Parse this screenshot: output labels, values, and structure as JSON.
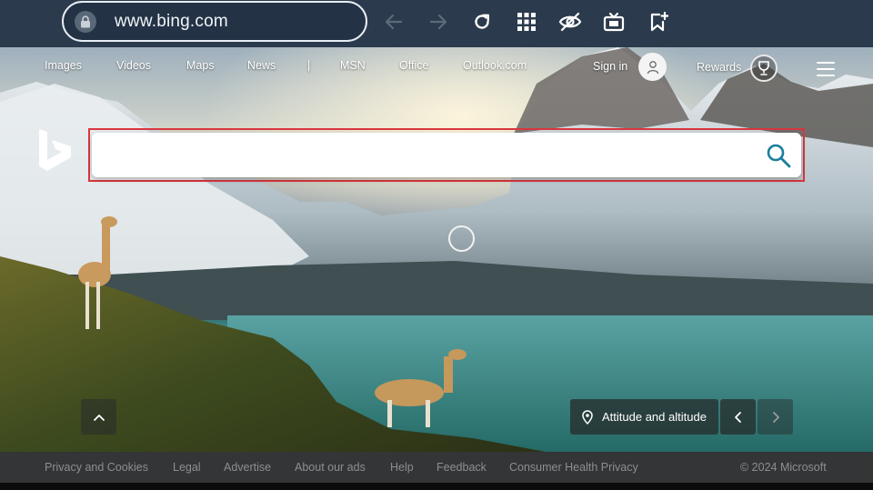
{
  "browser": {
    "url": "www.bing.com",
    "icons": [
      "lock-icon",
      "back-arrow-icon",
      "forward-arrow-icon",
      "reload-icon",
      "apps-grid-icon",
      "eye-off-icon",
      "tv-icon",
      "bookmark-add-icon"
    ]
  },
  "nav": {
    "links": [
      "Images",
      "Videos",
      "Maps",
      "News",
      "|",
      "MSN",
      "Office",
      "Outlook.com"
    ],
    "sign_in": "Sign in",
    "rewards": "Rewards"
  },
  "search": {
    "placeholder": "",
    "value": ""
  },
  "caption": {
    "text": "Attitude and altitude"
  },
  "footer": {
    "links": [
      "Privacy and Cookies",
      "Legal",
      "Advertise",
      "About our ads",
      "Help",
      "Feedback",
      "Consumer Health Privacy"
    ],
    "copyright": "© 2024 Microsoft"
  },
  "colors": {
    "chrome_bg": "#2b3a4c",
    "search_highlight": "#d9363e",
    "search_icon": "#1a7f9c",
    "footer_bg": "#333536"
  }
}
